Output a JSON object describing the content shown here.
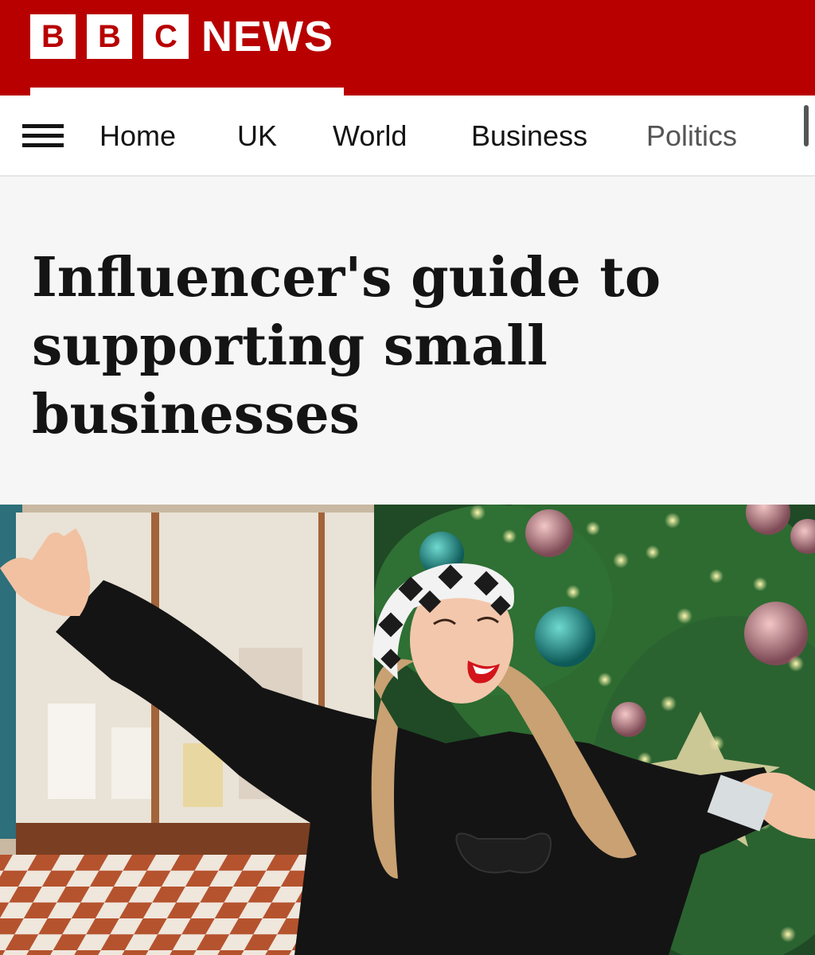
{
  "masthead": {
    "logo_letters": [
      "B",
      "B",
      "C"
    ],
    "logo_word": "NEWS",
    "brand_color": "#b80000"
  },
  "nav": {
    "menu_icon": "hamburger-menu-icon",
    "items": [
      {
        "label": "Home"
      },
      {
        "label": "UK"
      },
      {
        "label": "World"
      },
      {
        "label": "Business"
      },
      {
        "label": "Politics"
      }
    ]
  },
  "article": {
    "headline": "Influencer's guide to supporting small businesses"
  },
  "colors": {
    "accent": "#b80000",
    "text": "#141414",
    "background": "#f6f6f6"
  }
}
